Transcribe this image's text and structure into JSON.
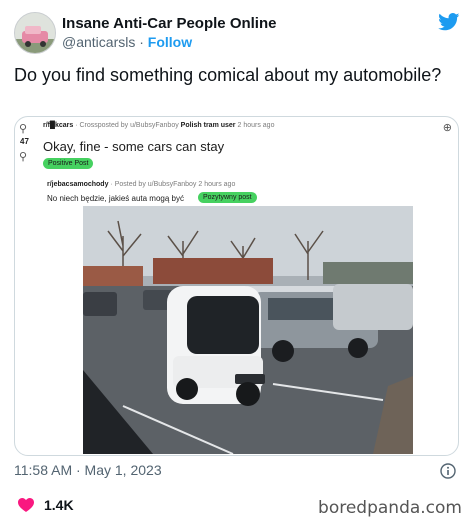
{
  "tweet": {
    "display_name": "Insane Anti-Car People Online",
    "handle": "@anticarsls",
    "separator": "·",
    "follow_label": "Follow",
    "text": "Do you find something comical about my automobile?",
    "timestamp": "11:58 AM · May 1, 2023",
    "likes": "1.4K"
  },
  "reddit_post": {
    "vote_count": "47",
    "subreddit": "r/f█kcars",
    "crosspost_text": "· Crossposted by u/BubsyFanboy",
    "user_flair": "Polish tram user",
    "time": "2 hours ago",
    "title": "Okay, fine - some cars can stay",
    "flair": "Positive Post"
  },
  "original_post": {
    "subreddit": "r/jebacsamochody",
    "posted_by": "· Posted by u/BubsyFanboy 2 hours ago",
    "title": "No niech będzie, jakieś auta mogą być",
    "flair": "Pozytywny post"
  },
  "watermark": "boredpanda.com",
  "colors": {
    "twitter_blue": "#1d9bf0",
    "heart_red": "#f91880",
    "flair_green": "#46d160",
    "muted_text": "#536471"
  },
  "icons": [
    "twitter-bird-icon",
    "info-icon",
    "heart-icon",
    "bike-icon",
    "upvote-icon",
    "downvote-icon"
  ]
}
